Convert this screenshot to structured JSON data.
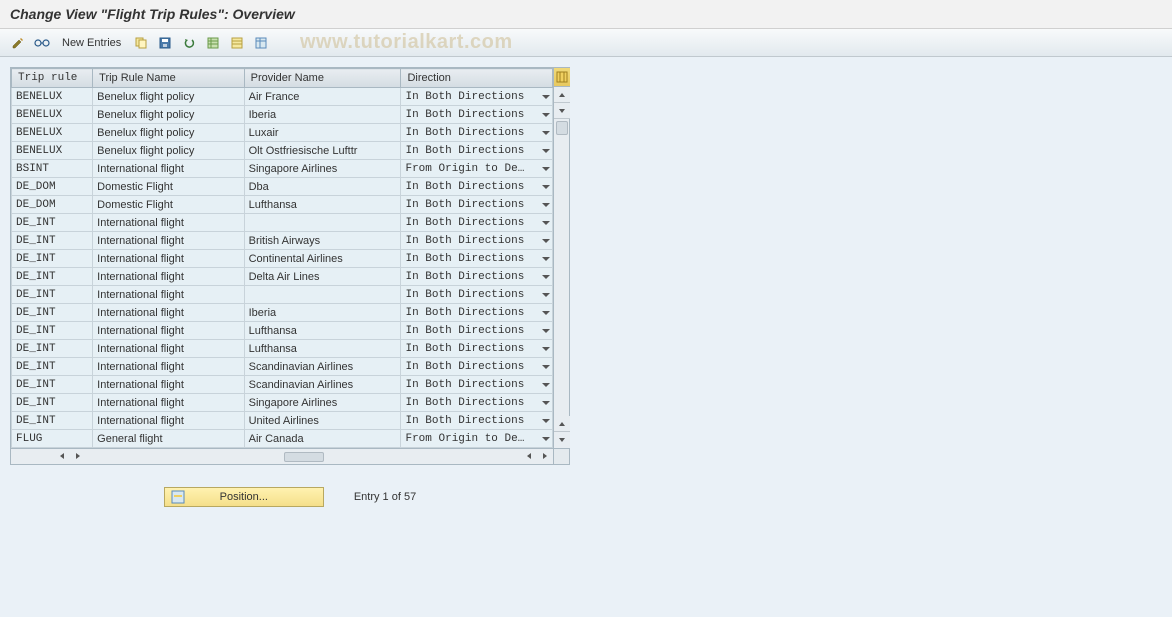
{
  "title": "Change View \"Flight Trip Rules\": Overview",
  "toolbar": {
    "new_entries": "New Entries"
  },
  "watermark": "www.tutorialkart.com",
  "headers": {
    "trip_rule": "Trip rule",
    "trip_rule_name": "Trip Rule Name",
    "provider_name": "Provider Name",
    "direction": "Direction"
  },
  "rows": [
    {
      "rule": "BENELUX",
      "name": "Benelux flight policy",
      "provider": "Air France",
      "direction": "In Both Directions"
    },
    {
      "rule": "BENELUX",
      "name": "Benelux flight policy",
      "provider": "Iberia",
      "direction": "In Both Directions"
    },
    {
      "rule": "BENELUX",
      "name": "Benelux flight policy",
      "provider": "Luxair",
      "direction": "In Both Directions"
    },
    {
      "rule": "BENELUX",
      "name": "Benelux flight policy",
      "provider": "Olt Ostfriesische Lufttr",
      "direction": "In Both Directions"
    },
    {
      "rule": "BSINT",
      "name": "International flight",
      "provider": "Singapore Airlines",
      "direction": "From Origin to De…"
    },
    {
      "rule": "DE_DOM",
      "name": "Domestic Flight",
      "provider": "Dba",
      "direction": "In Both Directions"
    },
    {
      "rule": "DE_DOM",
      "name": "Domestic Flight",
      "provider": "Lufthansa",
      "direction": "In Both Directions"
    },
    {
      "rule": "DE_INT",
      "name": "International flight",
      "provider": "",
      "direction": "In Both Directions"
    },
    {
      "rule": "DE_INT",
      "name": "International flight",
      "provider": "British Airways",
      "direction": "In Both Directions"
    },
    {
      "rule": "DE_INT",
      "name": "International flight",
      "provider": "Continental Airlines",
      "direction": "In Both Directions"
    },
    {
      "rule": "DE_INT",
      "name": "International flight",
      "provider": "Delta Air Lines",
      "direction": "In Both Directions"
    },
    {
      "rule": "DE_INT",
      "name": "International flight",
      "provider": "",
      "direction": "In Both Directions"
    },
    {
      "rule": "DE_INT",
      "name": "International flight",
      "provider": "Iberia",
      "direction": "In Both Directions"
    },
    {
      "rule": "DE_INT",
      "name": "International flight",
      "provider": "Lufthansa",
      "direction": "In Both Directions"
    },
    {
      "rule": "DE_INT",
      "name": "International flight",
      "provider": "Lufthansa",
      "direction": "In Both Directions"
    },
    {
      "rule": "DE_INT",
      "name": "International flight",
      "provider": "Scandinavian Airlines",
      "direction": "In Both Directions"
    },
    {
      "rule": "DE_INT",
      "name": "International flight",
      "provider": "Scandinavian Airlines",
      "direction": "In Both Directions"
    },
    {
      "rule": "DE_INT",
      "name": "International flight",
      "provider": "Singapore Airlines",
      "direction": "In Both Directions"
    },
    {
      "rule": "DE_INT",
      "name": "International flight",
      "provider": "United Airlines",
      "direction": "In Both Directions"
    },
    {
      "rule": "FLUG",
      "name": "General flight",
      "provider": "Air Canada",
      "direction": "From Origin to De…"
    }
  ],
  "footer": {
    "position": "Position...",
    "entry_info": "Entry 1 of 57"
  }
}
